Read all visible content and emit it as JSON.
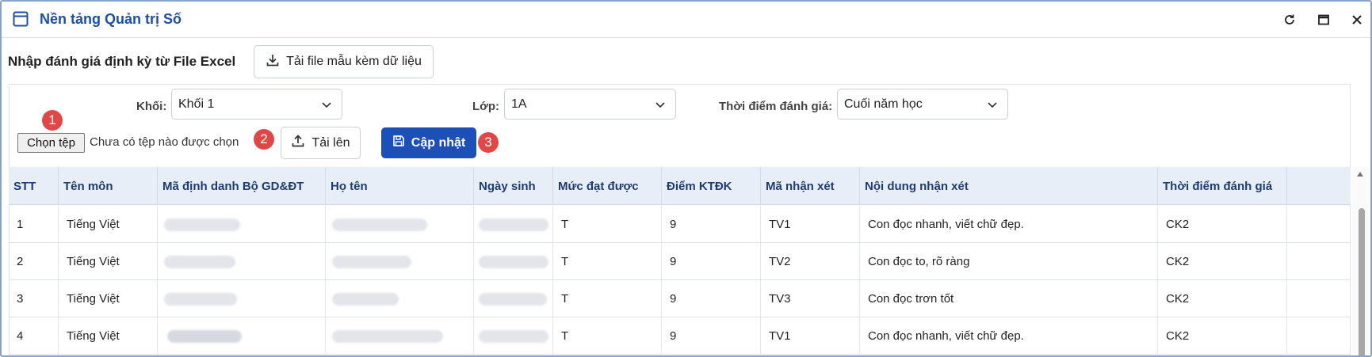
{
  "window": {
    "title": "Nền tảng Quản trị Số",
    "icons": {
      "app": "window-icon",
      "refresh": "refresh-icon",
      "maximize": "maximize-icon",
      "close": "close-icon"
    }
  },
  "header": {
    "title": "Nhập đánh giá định kỳ từ File Excel",
    "template_button": "Tải file mẫu kèm dữ liệu"
  },
  "filters": {
    "khoi_label": "Khối:",
    "khoi_value": "Khối 1",
    "lop_label": "Lớp:",
    "lop_value": "1A",
    "thoidiem_label": "Thời điểm đánh giá:",
    "thoidiem_value": "Cuối năm học"
  },
  "upload": {
    "choose_file": "Chọn tệp",
    "no_file": "Chưa có tệp nào được chọn",
    "upload_button": "Tải lên",
    "update_button": "Cập nhật",
    "steps": [
      "1",
      "2",
      "3"
    ]
  },
  "table": {
    "headers": [
      "STT",
      "Tên môn",
      "Mã định danh Bộ GD&ĐT",
      "Họ tên",
      "Ngày sinh",
      "Mức đạt được",
      "Điểm KTĐK",
      "Mã nhận xét",
      "Nội dung nhận xét",
      "Thời điểm đánh giá",
      ""
    ],
    "rows": [
      {
        "stt": "1",
        "mon": "Tiếng Việt",
        "muc": "T",
        "diem": "9",
        "ma_nx": "TV1",
        "noidung": "Con đọc nhanh, viết chữ đẹp.",
        "thoidiem": "CK2"
      },
      {
        "stt": "2",
        "mon": "Tiếng Việt",
        "muc": "T",
        "diem": "9",
        "ma_nx": "TV2",
        "noidung": "Con đọc to, rõ ràng",
        "thoidiem": "CK2"
      },
      {
        "stt": "3",
        "mon": "Tiếng Việt",
        "muc": "T",
        "diem": "9",
        "ma_nx": "TV3",
        "noidung": "Con đọc trơn tốt",
        "thoidiem": "CK2"
      },
      {
        "stt": "4",
        "mon": "Tiếng Việt",
        "muc": "T",
        "diem": "9",
        "ma_nx": "TV1",
        "noidung": "Con đọc nhanh, viết chữ đẹp.",
        "thoidiem": "CK2"
      }
    ]
  },
  "colors": {
    "accent": "#1d4fb8",
    "title": "#1f4fa3",
    "badge": "#e04848",
    "header_bg": "#e8eef8"
  }
}
